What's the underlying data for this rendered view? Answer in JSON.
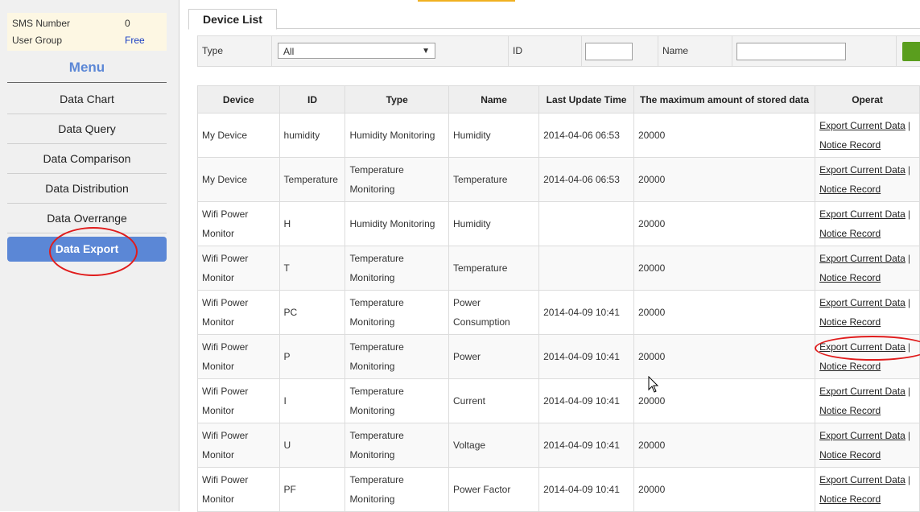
{
  "sidebar": {
    "info": [
      {
        "label": "SMS Number",
        "value": "0"
      },
      {
        "label": "User Group",
        "value": "Free"
      }
    ],
    "menu_title": "Menu",
    "items": [
      {
        "label": "Data Chart"
      },
      {
        "label": "Data Query"
      },
      {
        "label": "Data Comparison"
      },
      {
        "label": "Data Distribution"
      },
      {
        "label": "Data Overrange"
      },
      {
        "label": "Data Export",
        "active": true
      }
    ]
  },
  "tab": {
    "label": "Device List"
  },
  "filters": {
    "type_label": "Type",
    "type_value": "All",
    "id_label": "ID",
    "id_value": "",
    "name_label": "Name",
    "name_value": ""
  },
  "table": {
    "headers": [
      "Device",
      "ID",
      "Type",
      "Name",
      "Last Update Time",
      "The maximum amount of stored data",
      "Operat"
    ],
    "operation_links": [
      "Export Current Data",
      "Notice Record"
    ],
    "operation_separator": "|",
    "rows": [
      {
        "device": "My Device",
        "id": "humidity",
        "type": "Humidity Monitoring",
        "name": "Humidity",
        "last_update": "2014-04-06 06:53",
        "max_data": "20000"
      },
      {
        "device": "My Device",
        "id": "Temperature",
        "type": "Temperature Monitoring",
        "name": "Temperature",
        "last_update": "2014-04-06 06:53",
        "max_data": "20000"
      },
      {
        "device": "Wifi Power Monitor",
        "id": "H",
        "type": "Humidity Monitoring",
        "name": "Humidity",
        "last_update": "",
        "max_data": "20000"
      },
      {
        "device": "Wifi Power Monitor",
        "id": "T",
        "type": "Temperature Monitoring",
        "name": "Temperature",
        "last_update": "",
        "max_data": "20000"
      },
      {
        "device": "Wifi Power Monitor",
        "id": "PC",
        "type": "Temperature Monitoring",
        "name": "Power Consumption",
        "last_update": "2014-04-09 10:41",
        "max_data": "20000"
      },
      {
        "device": "Wifi Power Monitor",
        "id": "P",
        "type": "Temperature Monitoring",
        "name": "Power",
        "last_update": "2014-04-09 10:41",
        "max_data": "20000"
      },
      {
        "device": "Wifi Power Monitor",
        "id": "I",
        "type": "Temperature Monitoring",
        "name": "Current",
        "last_update": "2014-04-09 10:41",
        "max_data": "20000"
      },
      {
        "device": "Wifi Power Monitor",
        "id": "U",
        "type": "Temperature Monitoring",
        "name": "Voltage",
        "last_update": "2014-04-09 10:41",
        "max_data": "20000"
      },
      {
        "device": "Wifi Power Monitor",
        "id": "PF",
        "type": "Temperature Monitoring",
        "name": "Power Factor",
        "last_update": "2014-04-09 10:41",
        "max_data": "20000"
      }
    ]
  },
  "colors": {
    "menu_accent": "#5b87d6",
    "annotation_red": "#e01c1c",
    "search_button_green": "#5a9e1e"
  }
}
